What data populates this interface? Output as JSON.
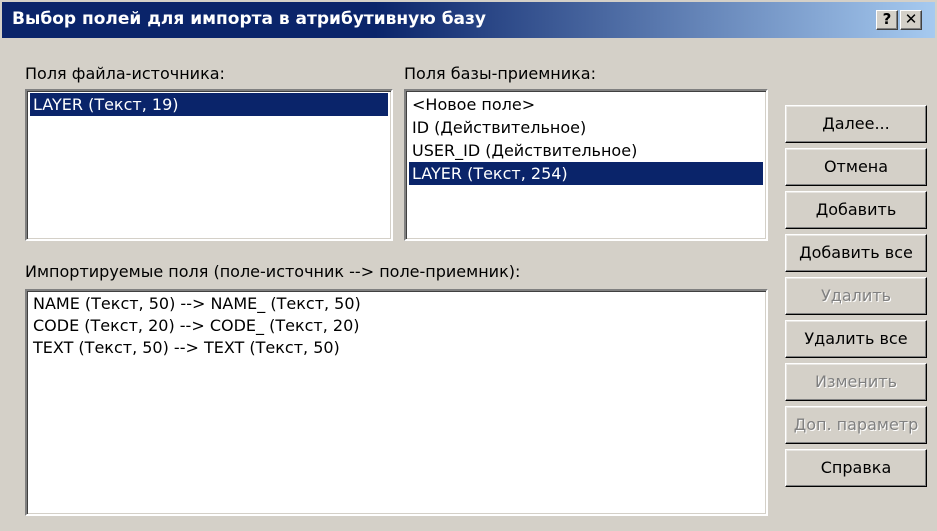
{
  "window": {
    "title": "Выбор полей для импорта в атрибутивную базу",
    "help_button": "?",
    "close_button": "✕"
  },
  "source_fields": {
    "label": "Поля файла-источника:",
    "items": [
      "LAYER (Текст, 19)"
    ],
    "selected_index": 0
  },
  "target_fields": {
    "label": "Поля базы-приемника:",
    "items": [
      "<Новое поле>",
      "ID (Действительное)",
      "USER_ID (Действительное)",
      "LAYER (Текст, 254)"
    ],
    "selected_index": 3
  },
  "imported_fields": {
    "label": "Импортируемые поля (поле-источник --> поле-приемник):",
    "items": [
      "NAME (Текст, 50) --> NAME_ (Текст, 50)",
      "CODE (Текст, 20) --> CODE_ (Текст, 20)",
      "TEXT (Текст, 50) --> TEXT (Текст, 50)"
    ]
  },
  "buttons": {
    "next": "Далее...",
    "cancel": "Отмена",
    "add": "Добавить",
    "add_all": "Добавить все",
    "remove": "Удалить",
    "remove_all": "Удалить все",
    "edit": "Изменить",
    "extra_params": "Доп. параметр",
    "help": "Справка"
  },
  "button_states": {
    "remove_enabled": false,
    "edit_enabled": false,
    "extra_params_enabled": false
  },
  "colors": {
    "title_bar": "#0a246a",
    "selection": "#0a246a",
    "dialog_face": "#d4d0c8"
  }
}
